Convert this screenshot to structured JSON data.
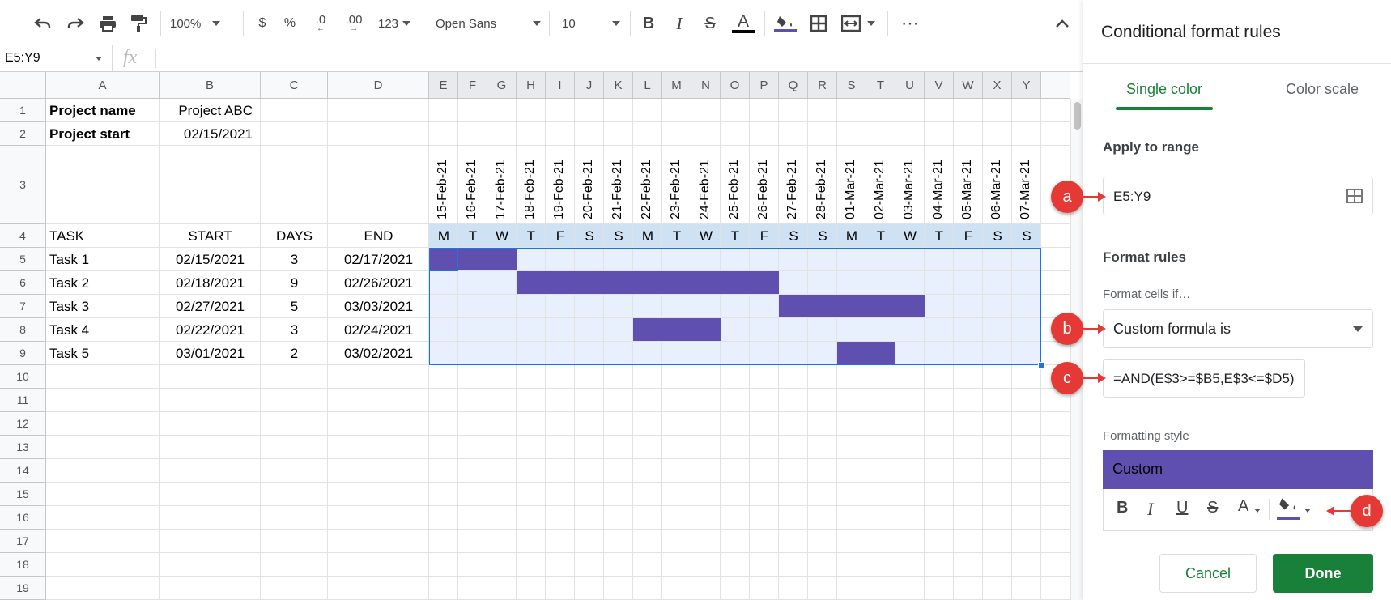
{
  "toolbar": {
    "zoom": "100%",
    "currency": "$",
    "percent": "%",
    "dec_decrease": ".0",
    "dec_increase": ".00",
    "more_formats": "123",
    "font": "Open Sans",
    "font_size": "10",
    "bold": "B",
    "italic": "I",
    "strike": "S",
    "text_color": "A",
    "more": "⋯"
  },
  "formula_bar": {
    "name_box": "E5:Y9",
    "fx": "fx",
    "formula": ""
  },
  "columns": {
    "fixed": [
      "A",
      "B",
      "C",
      "D"
    ],
    "timeline": [
      "E",
      "F",
      "G",
      "H",
      "I",
      "J",
      "K",
      "L",
      "M",
      "N",
      "O",
      "P",
      "Q",
      "R",
      "S",
      "T",
      "U",
      "V",
      "W",
      "X",
      "Y"
    ]
  },
  "rows": [
    "1",
    "2",
    "3",
    "4",
    "5",
    "6",
    "7",
    "8",
    "9",
    "10",
    "11",
    "12",
    "13",
    "14",
    "15",
    "16",
    "17",
    "18",
    "19"
  ],
  "sheet": {
    "project_name_label": "Project name",
    "project_name_value": "Project ABC",
    "project_start_label": "Project start",
    "project_start_value": "02/15/2021",
    "headers": {
      "task": "TASK",
      "start": "START",
      "days": "DAYS",
      "end": "END"
    },
    "dates": [
      "15-Feb-21",
      "16-Feb-21",
      "17-Feb-21",
      "18-Feb-21",
      "19-Feb-21",
      "20-Feb-21",
      "21-Feb-21",
      "22-Feb-21",
      "23-Feb-21",
      "24-Feb-21",
      "25-Feb-21",
      "26-Feb-21",
      "27-Feb-21",
      "28-Feb-21",
      "01-Mar-21",
      "02-Mar-21",
      "03-Mar-21",
      "04-Mar-21",
      "05-Mar-21",
      "06-Mar-21",
      "07-Mar-21"
    ],
    "weekdays": [
      "M",
      "T",
      "W",
      "T",
      "F",
      "S",
      "S",
      "M",
      "T",
      "W",
      "T",
      "F",
      "S",
      "S",
      "M",
      "T",
      "W",
      "T",
      "F",
      "S",
      "S"
    ],
    "tasks": [
      {
        "name": "Task 1",
        "start": "02/15/2021",
        "days": "3",
        "end": "02/17/2021",
        "from": 0,
        "count": 3
      },
      {
        "name": "Task 2",
        "start": "02/18/2021",
        "days": "9",
        "end": "02/26/2021",
        "from": 3,
        "count": 9
      },
      {
        "name": "Task 3",
        "start": "02/27/2021",
        "days": "5",
        "end": "03/03/2021",
        "from": 12,
        "count": 5
      },
      {
        "name": "Task 4",
        "start": "02/22/2021",
        "days": "3",
        "end": "02/24/2021",
        "from": 7,
        "count": 3
      },
      {
        "name": "Task 5",
        "start": "03/01/2021",
        "days": "2",
        "end": "03/02/2021",
        "from": 14,
        "count": 2
      }
    ]
  },
  "panel": {
    "title": "Conditional format rules",
    "tab_single": "Single color",
    "tab_scale": "Color scale",
    "apply_label": "Apply to range",
    "range_value": "E5:Y9",
    "format_rules_label": "Format rules",
    "cells_if_label": "Format cells if…",
    "condition": "Custom formula is",
    "formula": "=AND(E$3>=$B5,E$3<=$D5)",
    "style_label": "Formatting style",
    "style_preview": "Custom",
    "fmt_bold": "B",
    "fmt_italic": "I",
    "fmt_underline": "U",
    "fmt_strike": "S",
    "fmt_text_color": "A",
    "cancel": "Cancel",
    "done": "Done"
  },
  "callouts": {
    "a": "a",
    "b": "b",
    "c": "c",
    "d": "d"
  },
  "colors": {
    "bar": "#5f4fae",
    "selection_fill": "#e8f0fe",
    "selection_border": "#1a73e8",
    "accent_green": "#188038",
    "callout_red": "#e53935"
  }
}
